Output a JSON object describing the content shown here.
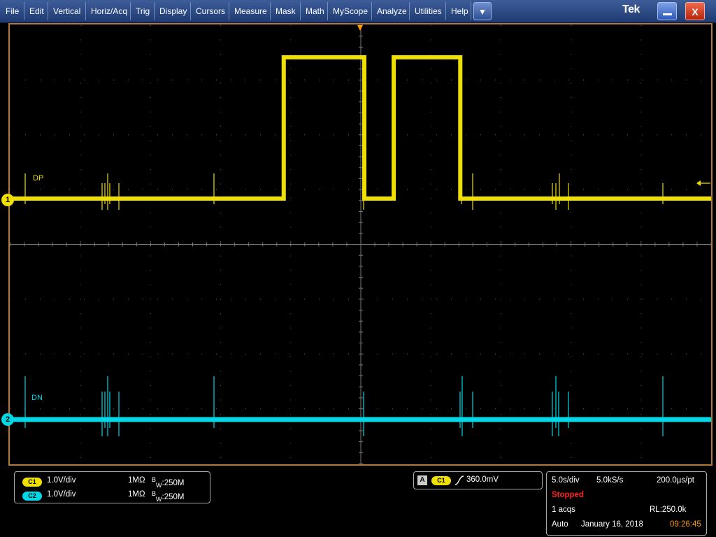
{
  "menu": {
    "items": [
      "File",
      "Edit",
      "Vertical",
      "Horiz/Acq",
      "Trig",
      "Display",
      "Cursors",
      "Measure",
      "Mask",
      "Math",
      "MyScope",
      "Analyze",
      "Utilities",
      "Help"
    ],
    "dropdown_icon": "chevron-down-icon",
    "logo": "Tek",
    "minimize_icon": "minimize-icon",
    "close_label": "X"
  },
  "colors": {
    "ch1": "#f0e000",
    "ch2": "#00d8e8",
    "grid": "#5a5a5a",
    "frame": "#b07a3a",
    "stopped": "#ff2020",
    "time": "#ff9a00"
  },
  "display": {
    "ch1_label": "DP",
    "ch2_label": "DN",
    "ch1_marker": "1",
    "ch2_marker": "2",
    "trigger_level_icon": "left-arrow-icon",
    "trigger_position_icon": "triangle-down-icon"
  },
  "waveforms": {
    "time_divisions": 10,
    "ch1_levels": [
      "low",
      "low",
      "low",
      "low",
      "high",
      "high",
      "low",
      "high",
      "high",
      "low",
      "low",
      "low",
      "low",
      "low"
    ],
    "ch1_transitions_div": [
      3.9,
      5.05,
      5.47,
      6.42
    ],
    "ch2_state": "low"
  },
  "channels": [
    {
      "chip": "C1",
      "scale": "1.0V/div",
      "impedance": "1MΩ",
      "bw_prefix": "B",
      "bw_sub": "W",
      "bw": ":250M"
    },
    {
      "chip": "C2",
      "scale": "1.0V/div",
      "impedance": "1MΩ",
      "bw_prefix": "B",
      "bw_sub": "W",
      "bw": ":250M"
    }
  ],
  "trigger": {
    "mode_badge": "A",
    "source": "C1",
    "slope_icon": "rising-edge-icon",
    "level": "360.0mV"
  },
  "acquisition": {
    "timebase": "5.0s/div",
    "sample_rate": "5.0kS/s",
    "resolution": "200.0µs/pt",
    "status": "Stopped",
    "acqs": "1 acqs",
    "record_length": "RL:250.0k",
    "trigger_mode": "Auto",
    "date": "January 16, 2018",
    "time": "09:26:45"
  }
}
